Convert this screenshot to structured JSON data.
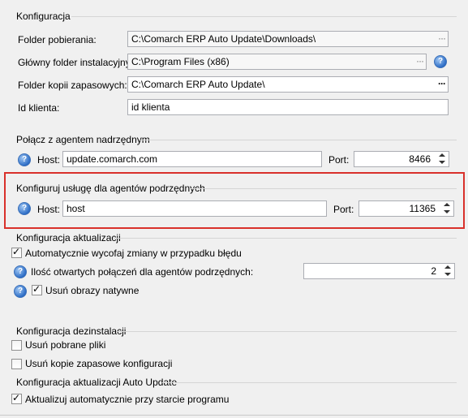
{
  "config": {
    "title": "Konfiguracja",
    "download_folder_label": "Folder pobierania:",
    "download_folder_value": "C:\\Comarch ERP Auto Update\\Downloads\\",
    "install_folder_label": "Główny folder instalacyjny:",
    "install_folder_value": "C:\\Program Files (x86)",
    "backup_folder_label": "Folder kopii zapasowych:",
    "backup_folder_value": "C:\\Comarch ERP Auto Update\\",
    "client_id_label": "Id klienta:",
    "client_id_value": "id klienta",
    "browse_label": "···"
  },
  "parent_agent": {
    "title": "Połącz z agentem nadrzędnym",
    "host_label": "Host:",
    "host_value": "update.comarch.com",
    "port_label": "Port:",
    "port_value": "8466"
  },
  "child_agents": {
    "title": "Konfiguruj usługę dla agentów podrzędnych",
    "host_label": "Host:",
    "host_value": "host",
    "port_label": "Port:",
    "port_value": "11365",
    "highlight_color": "#d9312b"
  },
  "update_config": {
    "title": "Konfiguracja aktualizacji",
    "auto_rollback_label": "Automatycznie wycofaj zmiany w przypadku błędu",
    "auto_rollback_checked": true,
    "open_connections_label": "Ilość otwartych połączeń dla agentów podrzędnych:",
    "open_connections_value": "2",
    "remove_native_images_label": "Usuń obrazy natywne",
    "remove_native_images_checked": true
  },
  "uninstall_config": {
    "title": "Konfiguracja dezinstalacji",
    "remove_downloaded_label": "Usuń pobrane pliki",
    "remove_downloaded_checked": false,
    "remove_backups_label": "Usuń kopie zapasowe konfiguracji",
    "remove_backups_checked": false
  },
  "autoupdate_config": {
    "title": "Konfiguracja aktualizacji Auto Update",
    "update_on_start_label": "Aktualizuj automatycznie przy starcie programu",
    "update_on_start_checked": true
  },
  "help_icon_glyph": "?"
}
